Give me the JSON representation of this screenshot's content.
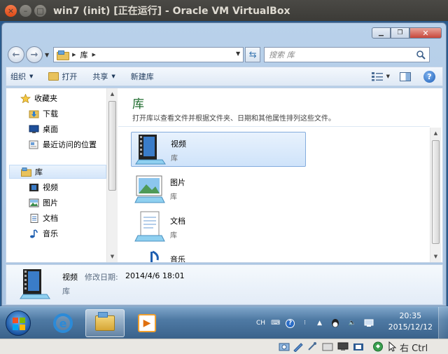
{
  "host_window": {
    "title": "win7 (init) [正在运行] - Oracle VM VirtualBox"
  },
  "explorer": {
    "breadcrumb": [
      "库"
    ],
    "search_placeholder": "搜索 库",
    "toolbar": {
      "organize": "组织",
      "open": "打开",
      "share": "共享",
      "new_library": "新建库"
    },
    "nav": {
      "favorites": {
        "label": "收藏夹",
        "items": [
          "下载",
          "桌面",
          "最近访问的位置"
        ]
      },
      "library": {
        "label": "库",
        "items": [
          "视频",
          "图片",
          "文档",
          "音乐"
        ]
      }
    },
    "main": {
      "heading": "库",
      "subtitle": "打开库以查看文件并根据文件夹、日期和其他属性排列这些文件。",
      "items": [
        {
          "name": "视频",
          "type": "库"
        },
        {
          "name": "图片",
          "type": "库"
        },
        {
          "name": "文档",
          "type": "库"
        },
        {
          "name": "音乐",
          "type": ""
        }
      ]
    },
    "details": {
      "name": "视频",
      "date_label": "修改日期:",
      "date_value": "2014/4/6 18:01",
      "type": "库"
    }
  },
  "taskbar": {
    "lang": "CH",
    "time": "20:35",
    "date": "2015/12/12"
  },
  "vbox_status": {
    "host_key": "右 Ctrl"
  }
}
